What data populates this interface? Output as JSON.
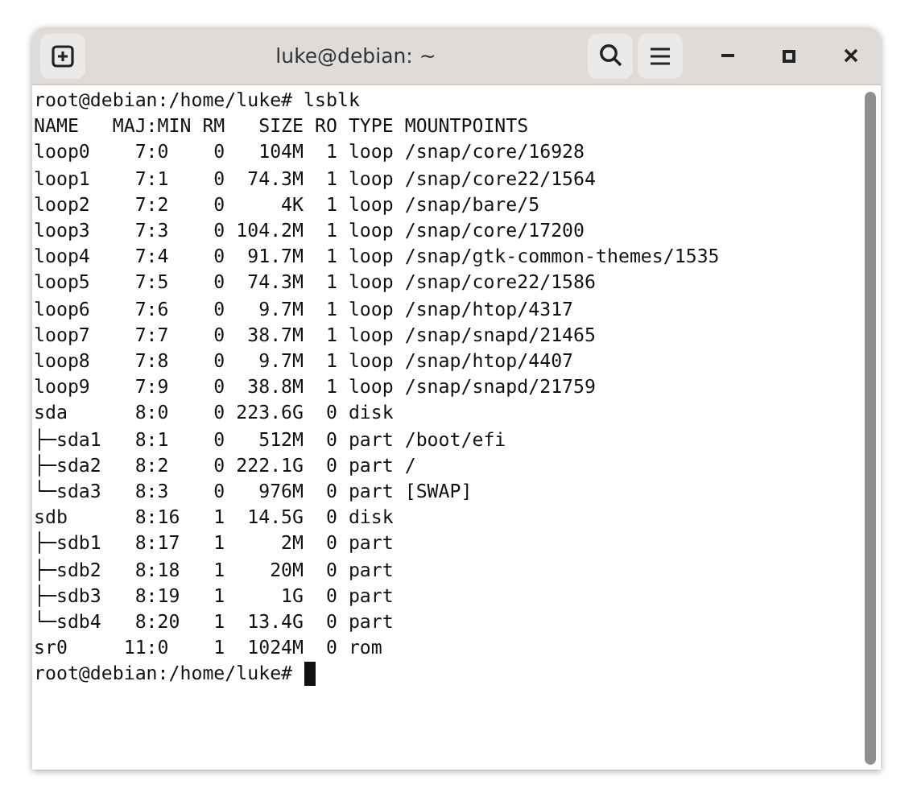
{
  "window": {
    "title": "luke@debian: ~"
  },
  "terminal": {
    "lines": [
      "root@debian:/home/luke# lsblk",
      "NAME   MAJ:MIN RM   SIZE RO TYPE MOUNTPOINTS",
      "loop0    7:0    0   104M  1 loop /snap/core/16928",
      "loop1    7:1    0  74.3M  1 loop /snap/core22/1564",
      "loop2    7:2    0     4K  1 loop /snap/bare/5",
      "loop3    7:3    0 104.2M  1 loop /snap/core/17200",
      "loop4    7:4    0  91.7M  1 loop /snap/gtk-common-themes/1535",
      "loop5    7:5    0  74.3M  1 loop /snap/core22/1586",
      "loop6    7:6    0   9.7M  1 loop /snap/htop/4317",
      "loop7    7:7    0  38.7M  1 loop /snap/snapd/21465",
      "loop8    7:8    0   9.7M  1 loop /snap/htop/4407",
      "loop9    7:9    0  38.8M  1 loop /snap/snapd/21759",
      "sda      8:0    0 223.6G  0 disk",
      "├─sda1   8:1    0   512M  0 part /boot/efi",
      "├─sda2   8:2    0 222.1G  0 part /",
      "└─sda3   8:3    0   976M  0 part [SWAP]",
      "sdb      8:16   1  14.5G  0 disk",
      "├─sdb1   8:17   1     2M  0 part",
      "├─sdb2   8:18   1    20M  0 part",
      "├─sdb3   8:19   1     1G  0 part",
      "└─sdb4   8:20   1  13.4G  0 part",
      "sr0     11:0    1  1024M  0 rom",
      "root@debian:/home/luke#"
    ]
  }
}
